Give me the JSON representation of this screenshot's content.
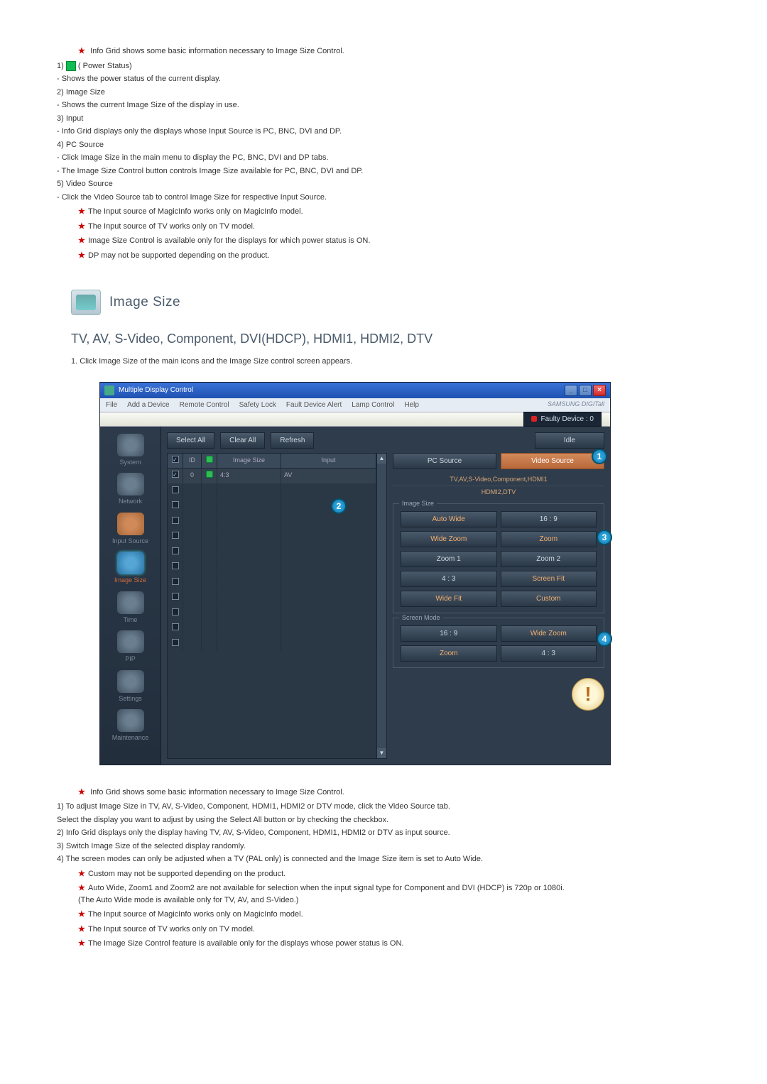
{
  "top_notes": {
    "info": "Info Grid shows some basic information necessary to Image Size Control.",
    "items": [
      {
        "num": "1)",
        "title": "( Power Status)",
        "subs": [
          "- Shows the power status of the current display."
        ],
        "icon": true
      },
      {
        "num": "2)",
        "title": "Image Size",
        "subs": [
          "- Shows the current Image Size of the display in use."
        ]
      },
      {
        "num": "3)",
        "title": "Input",
        "subs": [
          "- Info Grid displays only the displays whose Input Source is PC, BNC, DVI and DP."
        ]
      },
      {
        "num": "4)",
        "title": "PC Source",
        "subs": [
          "- Click Image Size in the main menu to display the PC, BNC, DVI and DP tabs.",
          "- The Image Size Control button controls Image Size available for PC, BNC, DVI and DP."
        ]
      },
      {
        "num": "5)",
        "title": "Video Source",
        "subs": [
          "- Click the Video Source tab to control Image Size for respective Input Source."
        ]
      }
    ],
    "stars": [
      "The Input source of MagicInfo works only on MagicInfo model.",
      "The Input source of TV works only on TV model.",
      "Image Size Control is available only for the displays for which power status is ON.",
      "DP may not be supported depending on the product."
    ]
  },
  "section_title": "Image Size",
  "subsection_title": "TV, AV, S-Video, Component, DVI(HDCP), HDMI1, HDMI2, DTV",
  "body_line": "1.  Click Image Size of the main icons and the Image Size control screen appears.",
  "app": {
    "title": "Multiple Display Control",
    "menu": [
      "File",
      "Add a Device",
      "Remote Control",
      "Safety Lock",
      "Fault Device Alert",
      "Lamp Control",
      "Help"
    ],
    "brand": "SAMSUNG DIGITall",
    "faulty": "Faulty Device : 0",
    "toolbar": {
      "select_all": "Select All",
      "clear_all": "Clear All",
      "refresh": "Refresh",
      "idle": "Idle"
    },
    "grid_headers": {
      "id": "ID",
      "image_size": "Image Size",
      "input": "Input"
    },
    "grid_row": {
      "id": "0",
      "image_size": "4:3",
      "input": "AV"
    },
    "sidebar": [
      {
        "label": "System"
      },
      {
        "label": "Network"
      },
      {
        "label": "Input Source"
      },
      {
        "label": "Image Size"
      },
      {
        "label": "Time"
      },
      {
        "label": "PIP"
      },
      {
        "label": "Settings"
      },
      {
        "label": "Maintenance"
      }
    ],
    "tabs": {
      "pc": "PC Source",
      "video": "Video Source"
    },
    "source_label_1": "TV,AV,S-Video,Component,HDMI1",
    "source_label_2": "HDMI2,DTV",
    "image_size_group": "Image Size",
    "image_size_btns": [
      "Auto Wide",
      "16 : 9",
      "Wide Zoom",
      "Zoom",
      "Zoom 1",
      "Zoom 2",
      "4 : 3",
      "Screen Fit",
      "Wide Fit",
      "Custom"
    ],
    "screen_mode_group": "Screen Mode",
    "screen_mode_btns": [
      "16 : 9",
      "Wide Zoom",
      "Zoom",
      "4 : 3"
    ],
    "callouts": {
      "c1": "1",
      "c2": "2",
      "c3": "3",
      "c4": "4"
    }
  },
  "bottom_notes": {
    "info": "Info Grid shows some basic information necessary to Image Size Control.",
    "items": [
      {
        "num": "1)",
        "lines": [
          "To adjust Image Size in TV, AV, S-Video, Component, HDMI1, HDMI2 or DTV mode, click the Video Source tab.",
          "Select the display you want to adjust by using the Select All button or by checking the checkbox."
        ]
      },
      {
        "num": "2)",
        "lines": [
          "Info Grid displays only the display having TV, AV, S-Video, Component, HDMI1, HDMI2 or DTV as input source."
        ]
      },
      {
        "num": "3)",
        "lines": [
          "Switch Image Size of the selected display randomly."
        ]
      },
      {
        "num": "4)",
        "lines": [
          "The screen modes can only be adjusted when a TV (PAL only) is connected and the Image Size item is set to Auto Wide."
        ]
      }
    ],
    "stars": [
      "Custom may not be supported depending on the product.",
      "Auto Wide, Zoom1 and Zoom2 are not available for selection when the input signal type for Component and DVI (HDCP) is 720p or 1080i.\n(The Auto Wide mode is available only for TV, AV, and S-Video.)",
      "The Input source of MagicInfo works only on MagicInfo model.",
      "The Input source of TV works only on TV model.",
      "The Image Size Control feature is available only for the displays whose power status is ON."
    ]
  }
}
